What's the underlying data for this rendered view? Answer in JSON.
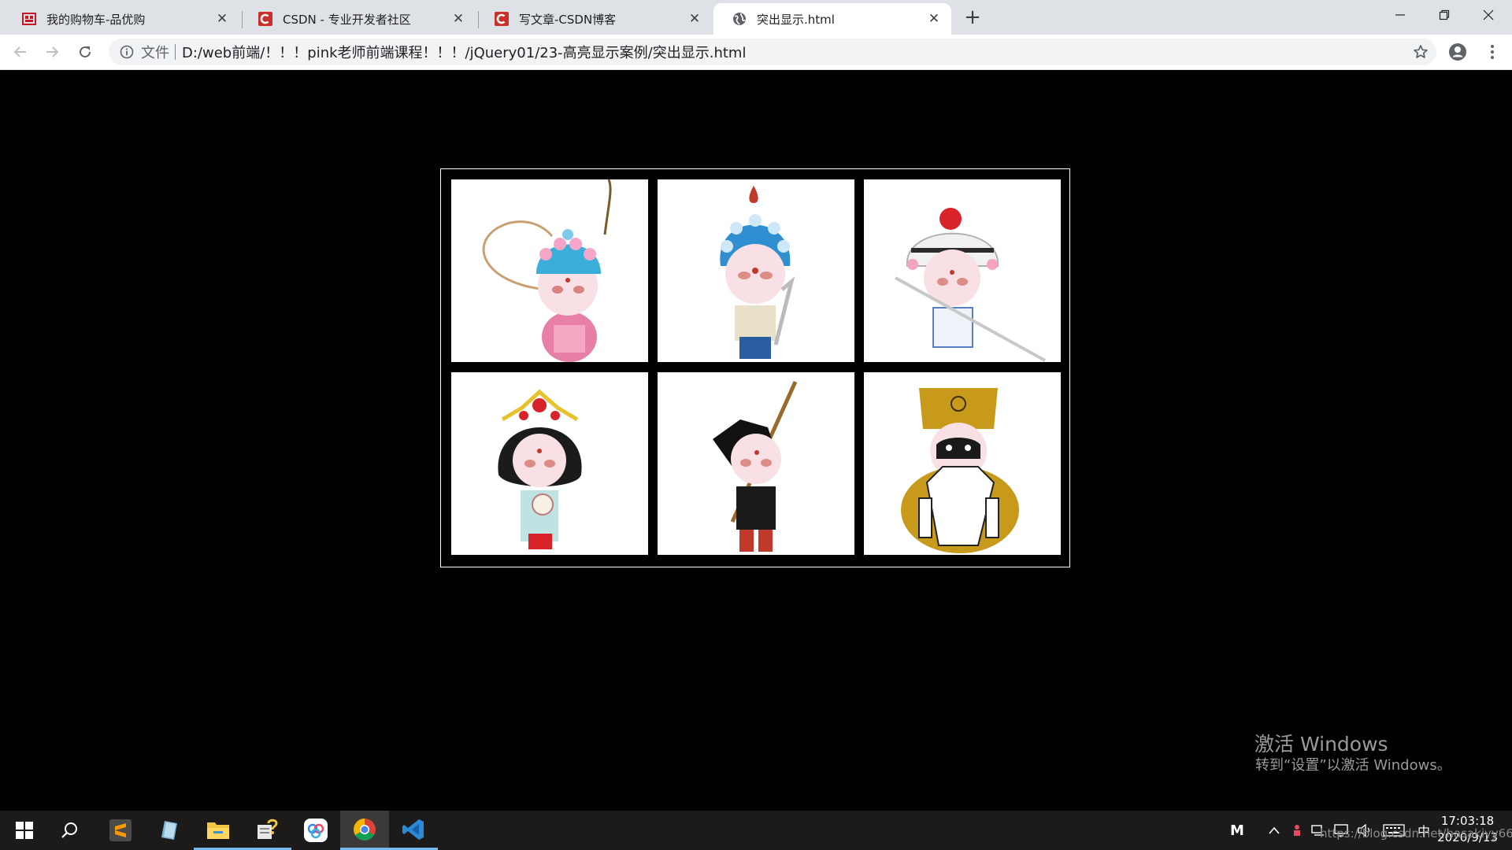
{
  "browser": {
    "tabs": [
      {
        "title": "我的购物车-品优购",
        "favicon": "shop-icon",
        "active": false
      },
      {
        "title": "CSDN - 专业开发者社区",
        "favicon": "csdn-icon",
        "active": false
      },
      {
        "title": "写文章-CSDN博客",
        "favicon": "csdn-icon",
        "active": false
      },
      {
        "title": "突出显示.html",
        "favicon": "globe-icon",
        "active": true
      }
    ],
    "new_tab_label": "+",
    "close_label": "✕",
    "address": {
      "scheme_label": "文件",
      "url": "D:/web前端/！！！pink老师前端课程！！！/jQuery01/23-高亮显示案例/突出显示.html"
    },
    "accent_color": "#1a73e8"
  },
  "page": {
    "background": "#000000",
    "gallery": {
      "border_color": "#ffffff",
      "images": [
        {
          "label": "opera-character-1",
          "icon": "pink-costume-pheasant-feather-figure"
        },
        {
          "label": "opera-character-2",
          "icon": "blue-helmet-warrior-figure"
        },
        {
          "label": "opera-character-3",
          "icon": "white-armor-general-figure"
        },
        {
          "label": "opera-character-4",
          "icon": "tasseled-headdress-lady-figure"
        },
        {
          "label": "opera-character-5",
          "icon": "black-hat-staff-figure"
        },
        {
          "label": "opera-character-6",
          "icon": "golden-robe-judge-figure"
        }
      ]
    }
  },
  "watermark": {
    "line1": "激活 Windows",
    "line2": "转到“设置”以激活 Windows。"
  },
  "taskbar": {
    "apps": [
      {
        "icon": "windows-start-icon",
        "state": "none"
      },
      {
        "icon": "search-icon",
        "state": "none"
      },
      {
        "icon": "sublime-text-icon",
        "state": "none"
      },
      {
        "icon": "notes-app-icon",
        "state": "none"
      },
      {
        "icon": "file-explorer-icon",
        "state": "open"
      },
      {
        "icon": "help-tool-icon",
        "state": "open"
      },
      {
        "icon": "baidu-netdisk-icon",
        "state": "none"
      },
      {
        "icon": "chrome-icon",
        "state": "active"
      },
      {
        "icon": "vscode-icon",
        "state": "open"
      }
    ],
    "ime_label": "M",
    "lang_label": "中",
    "clock_time": "17:03:18",
    "clock_date": "2020/9/13",
    "url_watermark": "https://blog.csdn.net/hasakiyy66"
  }
}
